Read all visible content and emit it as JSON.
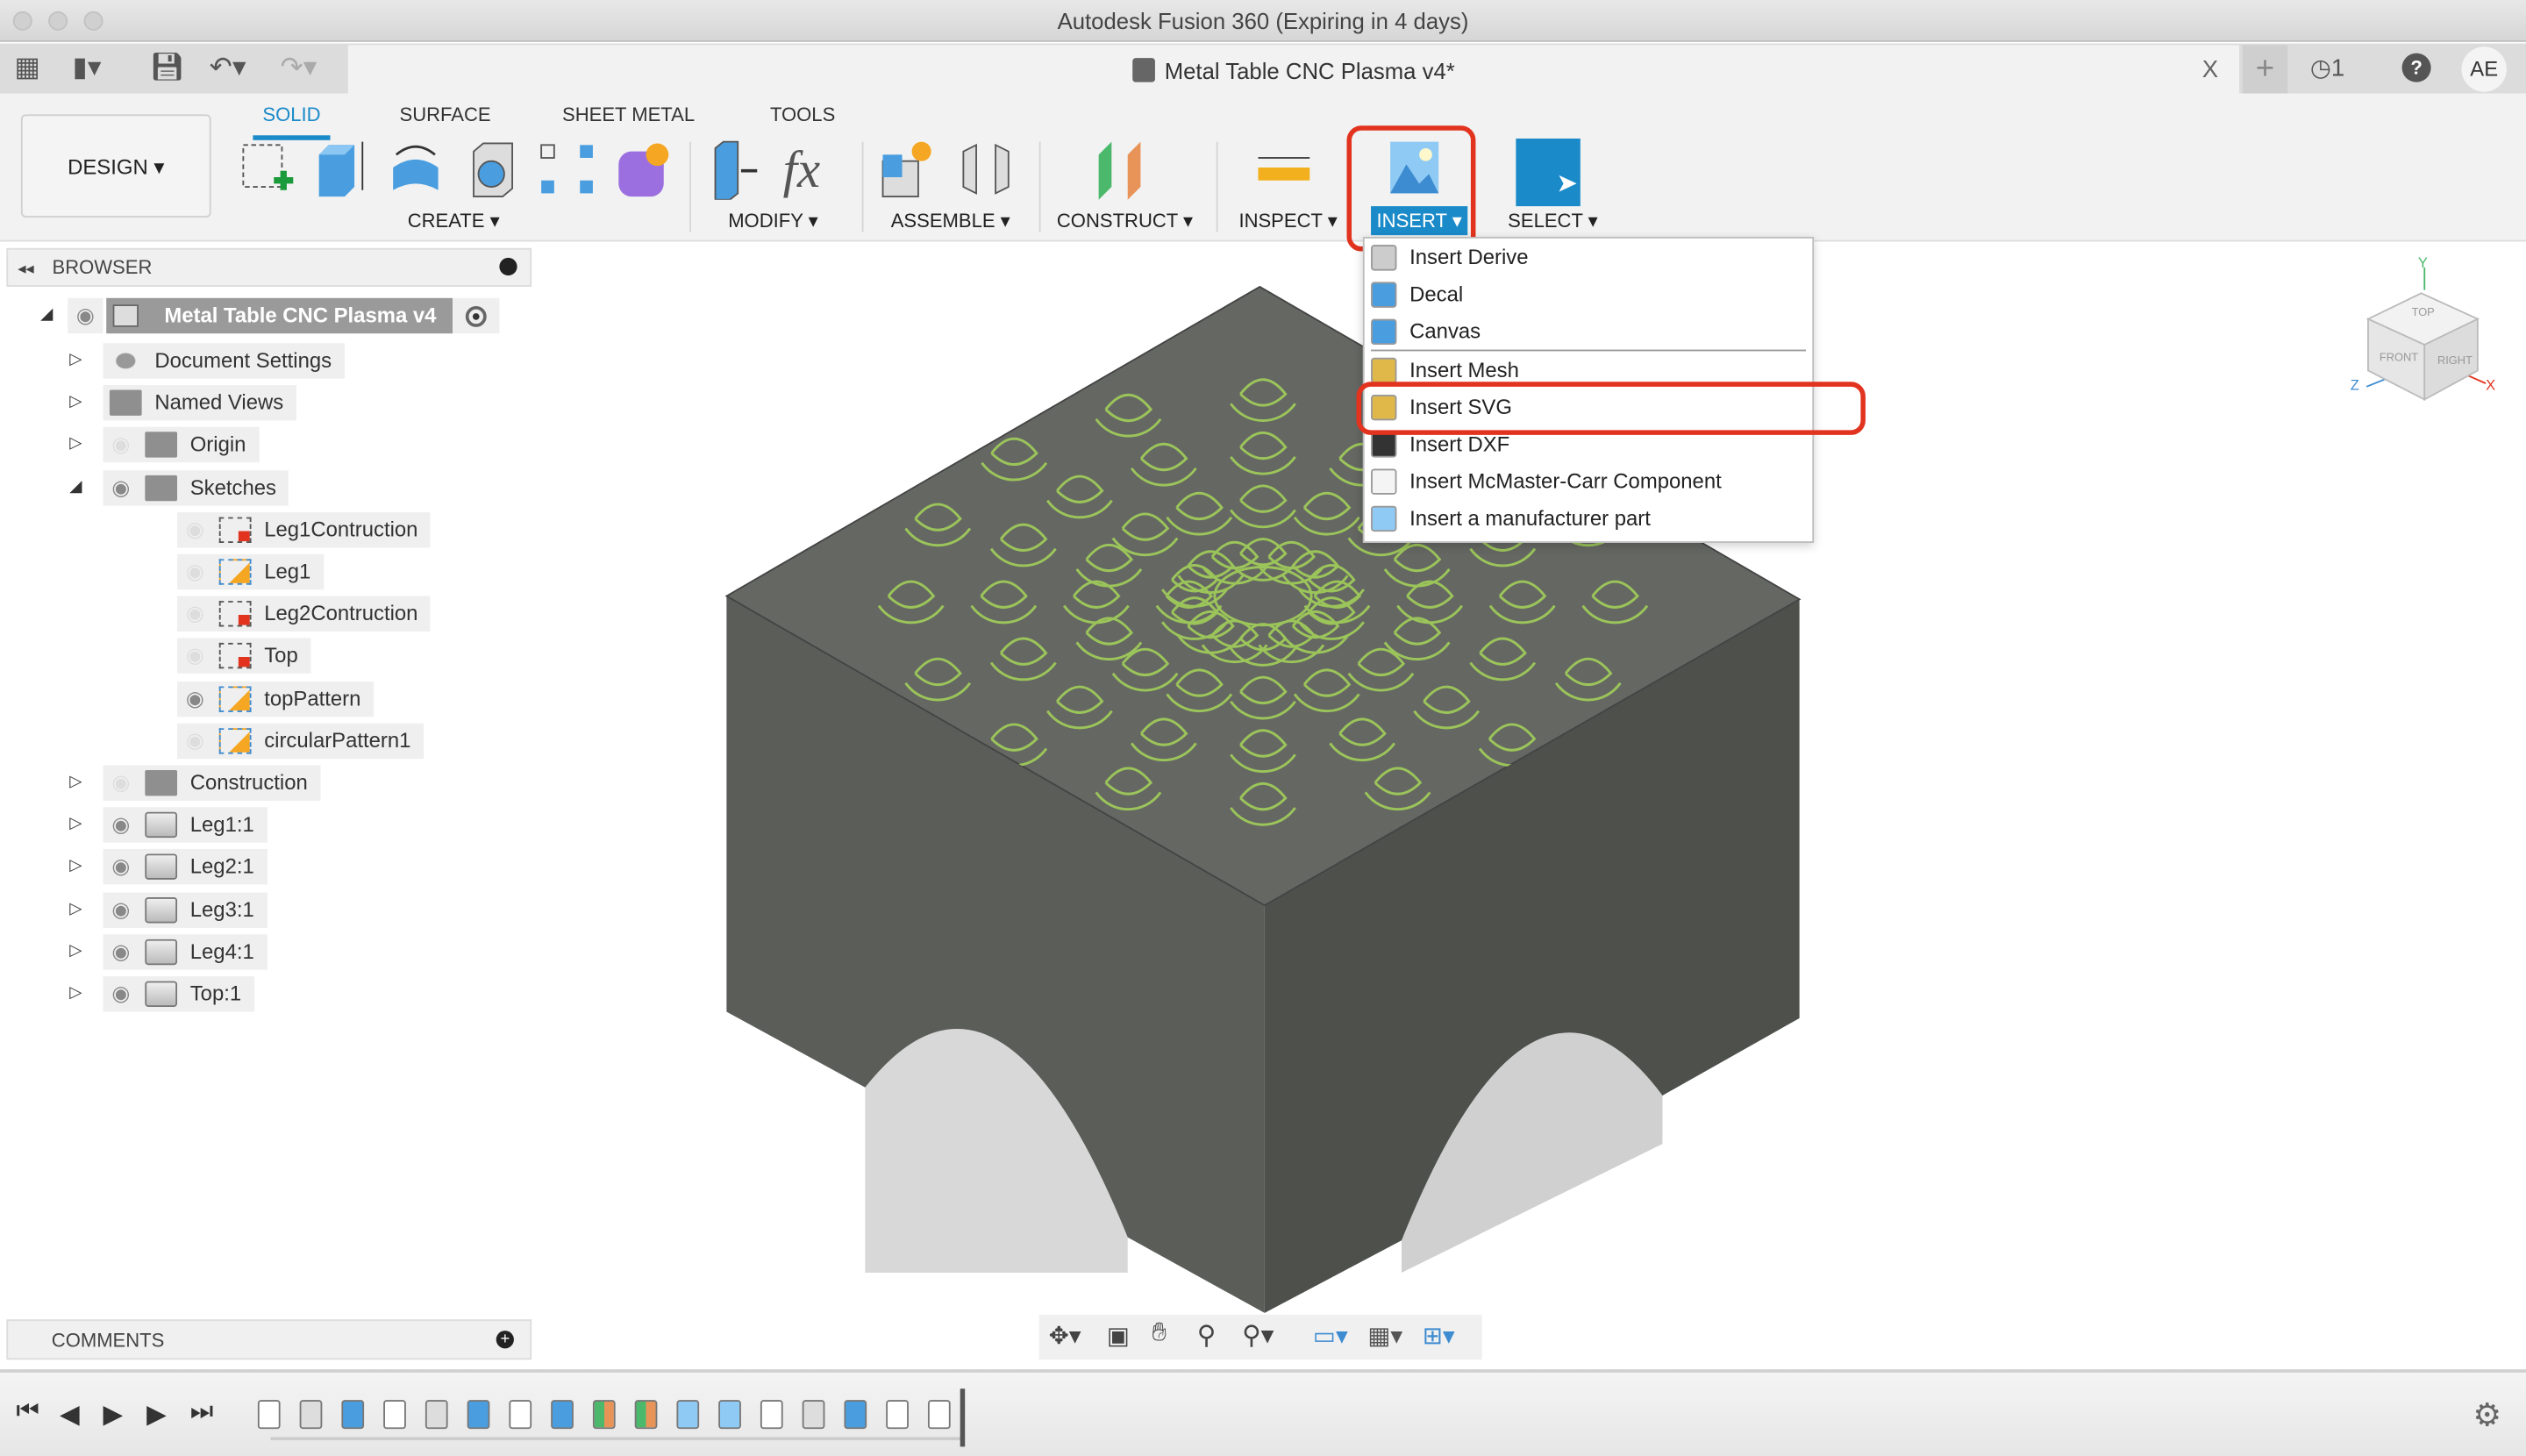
{
  "window": {
    "title": "Autodesk Fusion 360 (Expiring in 4 days)"
  },
  "document_tab": {
    "title": "Metal Table CNC Plasma v4*",
    "close": "X"
  },
  "quickbar": {
    "jobs_count": "1",
    "user_initials": "AE",
    "help": "?"
  },
  "workspace": {
    "label": "DESIGN ▾"
  },
  "ribbon": {
    "tabs": [
      {
        "label": "SOLID",
        "active": true
      },
      {
        "label": "SURFACE"
      },
      {
        "label": "SHEET METAL"
      },
      {
        "label": "TOOLS"
      }
    ],
    "groups": [
      {
        "label": "CREATE ▾"
      },
      {
        "label": "MODIFY ▾"
      },
      {
        "label": "ASSEMBLE ▾"
      },
      {
        "label": "CONSTRUCT ▾"
      },
      {
        "label": "INSPECT ▾"
      },
      {
        "label": "INSERT ▾",
        "active": true
      },
      {
        "label": "SELECT ▾"
      }
    ]
  },
  "insert_menu": {
    "items": [
      {
        "label": "Insert Derive",
        "icon": "derive-icon"
      },
      {
        "label": "Decal",
        "icon": "decal-icon"
      },
      {
        "label": "Canvas",
        "icon": "canvas-icon"
      },
      {
        "label": "Insert Mesh",
        "icon": "mesh-icon"
      },
      {
        "label": "Insert SVG",
        "icon": "svg-icon",
        "highlighted": true
      },
      {
        "label": "Insert DXF",
        "icon": "dxf-icon"
      },
      {
        "label": "Insert McMaster-Carr Component",
        "icon": "mcmaster-icon"
      },
      {
        "label": "Insert a manufacturer part",
        "icon": "manufacturer-part-icon"
      }
    ]
  },
  "browser": {
    "title": "BROWSER",
    "root": "Metal Table CNC Plasma v4",
    "items": [
      {
        "label": "Document Settings",
        "type": "settings",
        "level": 1,
        "expand": "closed",
        "eye": "none"
      },
      {
        "label": "Named Views",
        "type": "folder",
        "level": 1,
        "expand": "closed",
        "eye": "none"
      },
      {
        "label": "Origin",
        "type": "folder",
        "level": 1,
        "expand": "closed",
        "eye": "off"
      },
      {
        "label": "Sketches",
        "type": "folder",
        "level": 1,
        "expand": "open",
        "eye": "on"
      },
      {
        "label": "Leg1Contruction",
        "type": "sketch-locked",
        "level": 2,
        "eye": "off"
      },
      {
        "label": "Leg1",
        "type": "sketch",
        "level": 2,
        "eye": "off"
      },
      {
        "label": "Leg2Contruction",
        "type": "sketch-locked",
        "level": 2,
        "eye": "off"
      },
      {
        "label": "Top",
        "type": "sketch-locked",
        "level": 2,
        "eye": "off"
      },
      {
        "label": "topPattern",
        "type": "sketch",
        "level": 2,
        "eye": "on"
      },
      {
        "label": "circularPattern1",
        "type": "sketch",
        "level": 2,
        "eye": "off"
      },
      {
        "label": "Construction",
        "type": "folder",
        "level": 1,
        "expand": "closed",
        "eye": "off"
      },
      {
        "label": "Leg1:1",
        "type": "body",
        "level": 1,
        "expand": "closed",
        "eye": "on"
      },
      {
        "label": "Leg2:1",
        "type": "body",
        "level": 1,
        "expand": "closed",
        "eye": "on"
      },
      {
        "label": "Leg3:1",
        "type": "body",
        "level": 1,
        "expand": "closed",
        "eye": "on"
      },
      {
        "label": "Leg4:1",
        "type": "body",
        "level": 1,
        "expand": "closed",
        "eye": "on"
      },
      {
        "label": "Top:1",
        "type": "body",
        "level": 1,
        "expand": "closed",
        "eye": "on"
      }
    ]
  },
  "comments": {
    "title": "COMMENTS"
  },
  "viewcube": {
    "top": "TOP",
    "front": "FRONT",
    "right": "RIGHT",
    "x": "X",
    "y": "Y",
    "z": "Z"
  },
  "timeline": {
    "items": [
      "sketch",
      "box",
      "body",
      "sketch",
      "box",
      "body",
      "sketch",
      "body",
      "plane",
      "plane",
      "axis",
      "axis",
      "sketch",
      "box",
      "body",
      "sketch",
      "sketch"
    ]
  },
  "colors": {
    "accent": "#1b8ac9",
    "highlight": "#e2331f",
    "pattern": "#9bc45a",
    "body": "#5b5d59"
  }
}
